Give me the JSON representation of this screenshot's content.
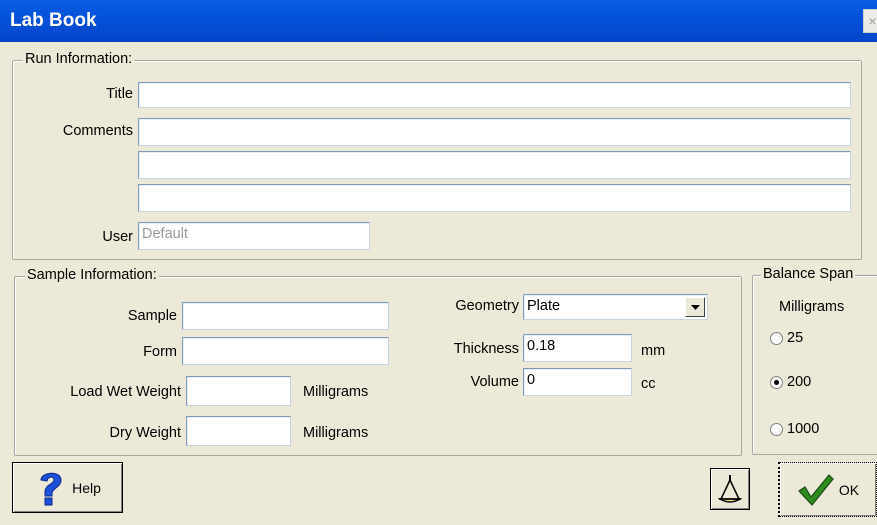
{
  "window": {
    "title": "Lab Book",
    "close_glyph": "×"
  },
  "run_info": {
    "legend": "Run Information:",
    "title_label": "Title",
    "title_value": "",
    "comments_label": "Comments",
    "comments_lines": [
      "",
      "",
      ""
    ],
    "user_label": "User",
    "user_value": "Default"
  },
  "sample_info": {
    "legend": "Sample Information:",
    "sample_label": "Sample",
    "sample_value": "",
    "form_label": "Form",
    "form_value": "",
    "load_wet_label": "Load Wet Weight",
    "load_wet_value": "",
    "load_wet_unit": "Milligrams",
    "dry_label": "Dry Weight",
    "dry_value": "",
    "dry_unit": "Milligrams",
    "geometry_label": "Geometry",
    "geometry_value": "Plate",
    "thickness_label": "Thickness",
    "thickness_value": "0.18",
    "thickness_unit": "mm",
    "volume_label": "Volume",
    "volume_value": "0",
    "volume_unit": "cc"
  },
  "balance": {
    "legend": "Balance Span",
    "unit": "Milligrams",
    "options": [
      {
        "label": "25",
        "checked": false
      },
      {
        "label": "200",
        "checked": true
      },
      {
        "label": "1000",
        "checked": false
      }
    ]
  },
  "buttons": {
    "help_label": "Help",
    "ok_label": "OK"
  },
  "icons": {
    "help": "question-mark-icon",
    "balance": "balance-icon",
    "ok": "checkmark-icon",
    "dropdown": "chevron-down-icon"
  },
  "colors": {
    "titlebar": "#0553db",
    "dialog_bg": "#ece9d8",
    "help_icon": "#1e4fd8",
    "ok_check": "#2e8b1f"
  }
}
